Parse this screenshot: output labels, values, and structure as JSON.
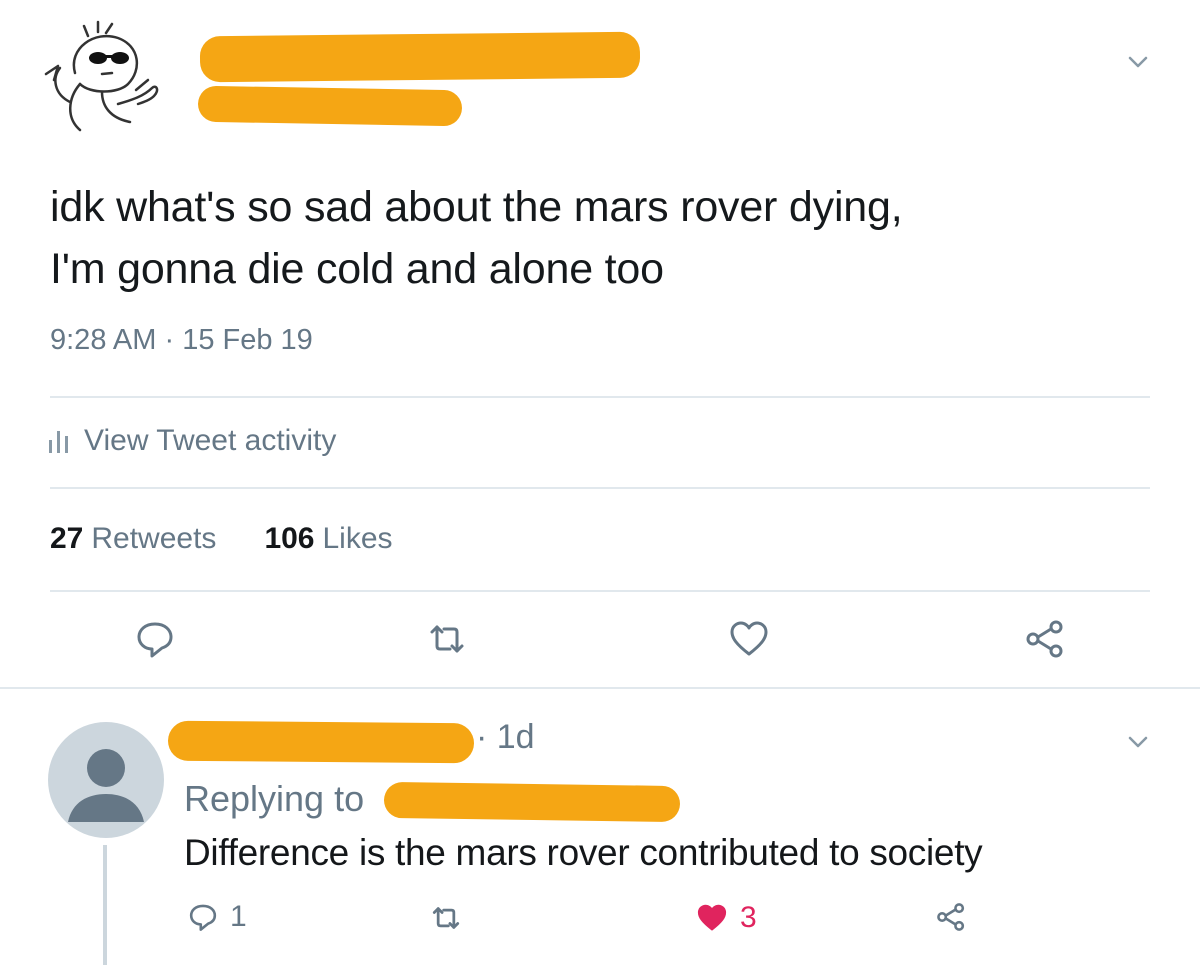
{
  "tweet": {
    "text_line1": "idk what's so sad about the mars rover dying,",
    "text_line2": "I'm gonna die cold and alone too",
    "time": "9:28 AM",
    "separator": "·",
    "date": "15 Feb 19",
    "activity_label": "View Tweet activity",
    "retweets_count": "27",
    "retweets_label": "Retweets",
    "likes_count": "106",
    "likes_label": "Likes"
  },
  "reply": {
    "time": "· 1d",
    "replying_to": "Replying to",
    "text": "Difference is the mars rover contributed to society",
    "reply_count": "1",
    "like_count": "3"
  },
  "icons": {
    "main_avatar": "cartoon-sunglasses-avatar",
    "chevron": "chevron-down-icon",
    "activity": "bar-chart-icon",
    "reply": "reply-bubble-icon",
    "retweet": "retweet-icon",
    "like": "heart-icon",
    "share": "share-icon",
    "default_avatar": "default-profile-avatar"
  },
  "colors": {
    "redaction": "#f5a614",
    "secondary_text": "#657786",
    "like_active": "#e0245e",
    "divider": "#e1e8ed"
  }
}
